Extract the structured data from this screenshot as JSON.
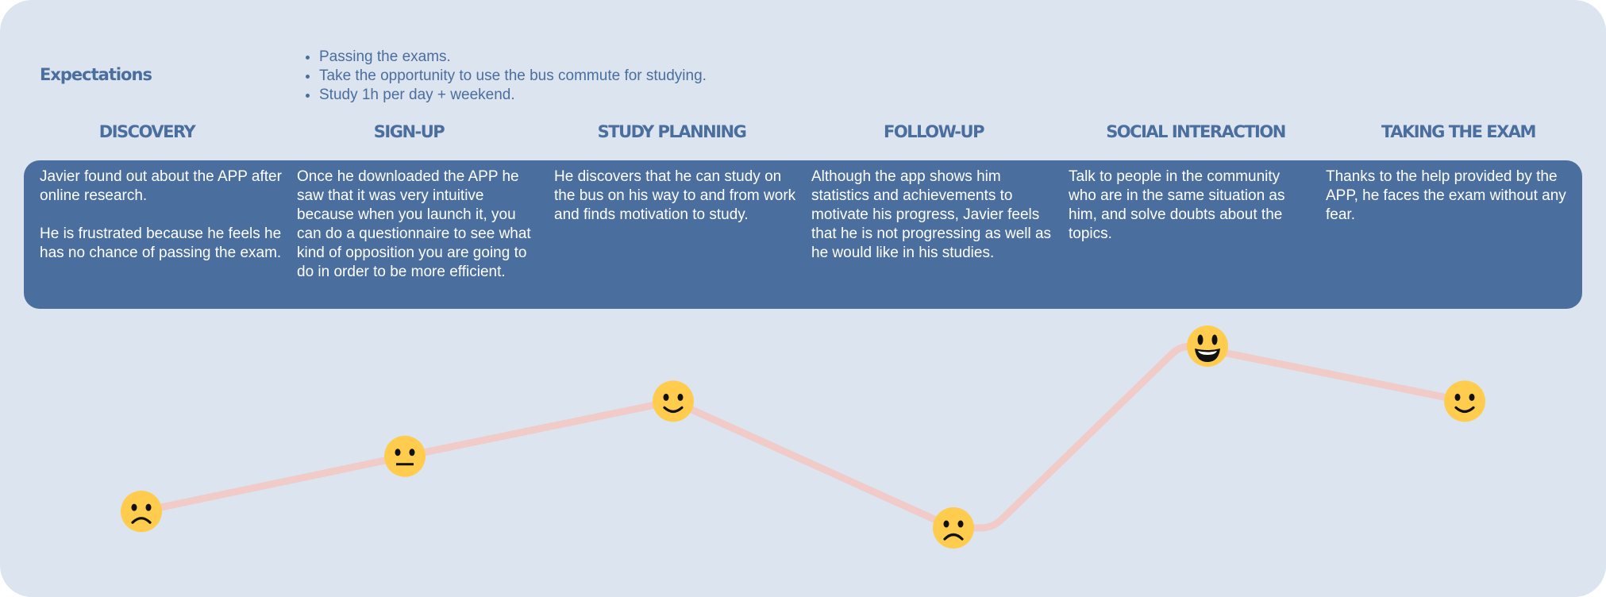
{
  "expectations": {
    "title": "Expectations",
    "items": [
      "Passing the exams.",
      "Take the opportunity to use the bus commute for studying.",
      "Study 1h per day + weekend."
    ]
  },
  "stages": [
    {
      "title": "DISCOVERY",
      "description": "Javier found out about the APP after online research.\n\nHe is frustrated because he feels he has no chance of passing the exam.",
      "emotion": "frowning",
      "emotion_level": 1
    },
    {
      "title": "SIGN-UP",
      "description": "Once he downloaded the APP he saw that it was very intuitive because when you launch it, you can do a questionnaire to see what kind of opposition you are going to do in order to be more efficient.",
      "emotion": "neutral",
      "emotion_level": 2
    },
    {
      "title": "STUDY PLANNING",
      "description": "He discovers that he can study on the bus on his way to and from work and finds motivation to study.",
      "emotion": "slightly-smiling",
      "emotion_level": 3
    },
    {
      "title": "FOLLOW-UP",
      "description": "Although the app shows him statistics and achievements to motivate his progress, Javier feels that he is not progressing as well as he would like in his studies.",
      "emotion": "frowning",
      "emotion_level": 0.7
    },
    {
      "title": "SOCIAL INTERACTION",
      "description": "Talk to people in the community who are in the same situation as him, and solve doubts about the topics.",
      "emotion": "grinning",
      "emotion_level": 4
    },
    {
      "title": "TAKING THE EXAM",
      "description": "Thanks to the help provided by the APP, he faces the exam without any fear.",
      "emotion": "slightly-smiling",
      "emotion_level": 3
    }
  ],
  "colors": {
    "panel_bg": "#DCE4EF",
    "accent": "#4A6E9E",
    "card_text": "#FFFFFF",
    "emotion_line": "#F0CBC8",
    "emoji_face": "#FFCC4D",
    "emoji_features": "#111111"
  }
}
